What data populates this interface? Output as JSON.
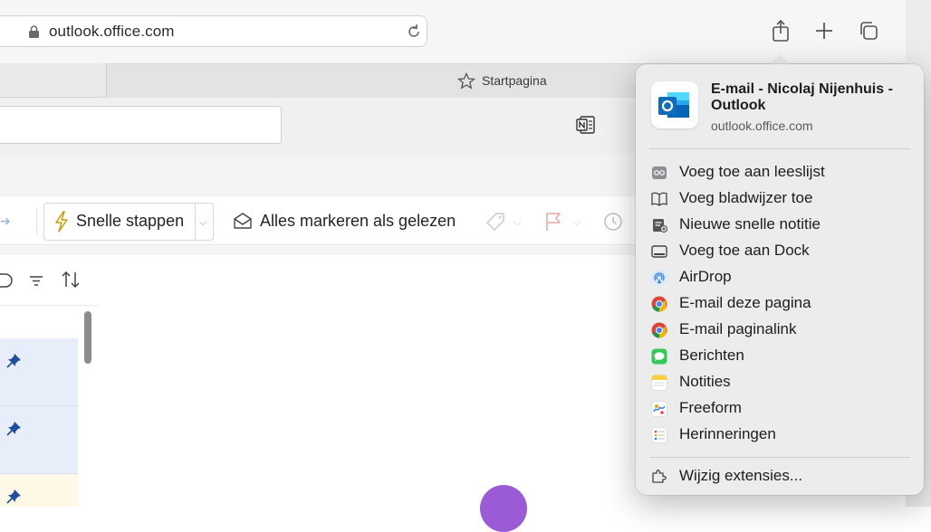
{
  "browser": {
    "url": "outlook.office.com",
    "active_tab": "Startpagina"
  },
  "ribbon": {
    "quick_steps": "Snelle stappen",
    "mark_all_read": "Alles markeren als gelezen"
  },
  "share_popover": {
    "title": "E-mail - Nicolaj Nijenhuis - Outlook",
    "subtitle": "outlook.office.com",
    "items": [
      {
        "label": "Voeg toe aan leeslijst",
        "icon": "reading-list-icon"
      },
      {
        "label": "Voeg bladwijzer toe",
        "icon": "bookmark-book-icon"
      },
      {
        "label": "Nieuwe snelle notitie",
        "icon": "quick-note-icon"
      },
      {
        "label": "Voeg toe aan Dock",
        "icon": "dock-icon"
      },
      {
        "label": "AirDrop",
        "icon": "airdrop-icon"
      },
      {
        "label": "E-mail deze pagina",
        "icon": "chrome-icon"
      },
      {
        "label": "E-mail paginalink",
        "icon": "chrome-icon"
      },
      {
        "label": "Berichten",
        "icon": "messages-icon"
      },
      {
        "label": "Notities",
        "icon": "notes-icon"
      },
      {
        "label": "Freeform",
        "icon": "freeform-icon"
      },
      {
        "label": "Herinneringen",
        "icon": "reminders-icon"
      }
    ],
    "footer": "Wijzig extensies...",
    "colors": {
      "accent": "#0a64d2",
      "outlook_blue": "#0f6cbd",
      "messages_green": "#34c759"
    }
  }
}
